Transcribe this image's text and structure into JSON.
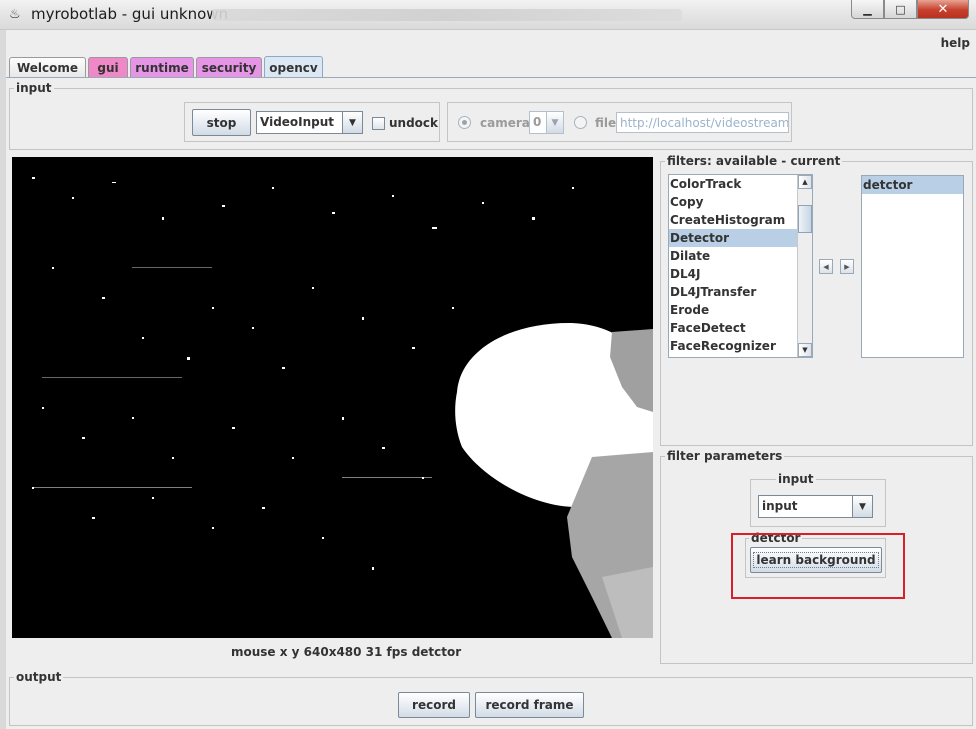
{
  "window": {
    "title": "myrobotlab - gui unknown",
    "icon": "java-coffee-icon",
    "controls": {
      "minimize": "▁",
      "maximize": "□",
      "close": "✕"
    }
  },
  "menu": {
    "help": "help"
  },
  "tabs": [
    {
      "label": "Welcome",
      "color": "#e6e6e6"
    },
    {
      "label": "gui",
      "color": "#ee88c6"
    },
    {
      "label": "runtime",
      "color": "#e594e6"
    },
    {
      "label": "security",
      "color": "#e594e6"
    },
    {
      "label": "opencv",
      "color": "#dbe8f4",
      "selected": true
    }
  ],
  "input_panel": {
    "title": "input",
    "stop_label": "stop",
    "grabber": "VideoInput",
    "undock_label": "undock",
    "undock_checked": false,
    "camera_label": "camera",
    "camera_index": "0",
    "camera_selected": true,
    "file_label": "file",
    "file_url": "http://localhost/videostream.cgi"
  },
  "video": {
    "status": "mouse x y  640x480  31 fps  detctor"
  },
  "filters": {
    "title": "filters: available - current",
    "available": [
      "ColorTrack",
      "Copy",
      "CreateHistogram",
      "Detector",
      "Dilate",
      "DL4J",
      "DL4JTransfer",
      "Erode",
      "FaceDetect",
      "FaceRecognizer"
    ],
    "selected_available": "Detector",
    "current": [
      "detctor"
    ],
    "selected_current": "detctor",
    "remove_arrow": "◀",
    "add_arrow": "▶"
  },
  "filter_parameters": {
    "title": "filter parameters",
    "input_title": "input",
    "input_value": "input",
    "detector_title": "detctor",
    "learn_background_label": "learn background"
  },
  "output_panel": {
    "title": "output",
    "record_label": "record",
    "record_frame_label": "record frame"
  },
  "annotation": {
    "highlight_color": "#d9202a"
  }
}
